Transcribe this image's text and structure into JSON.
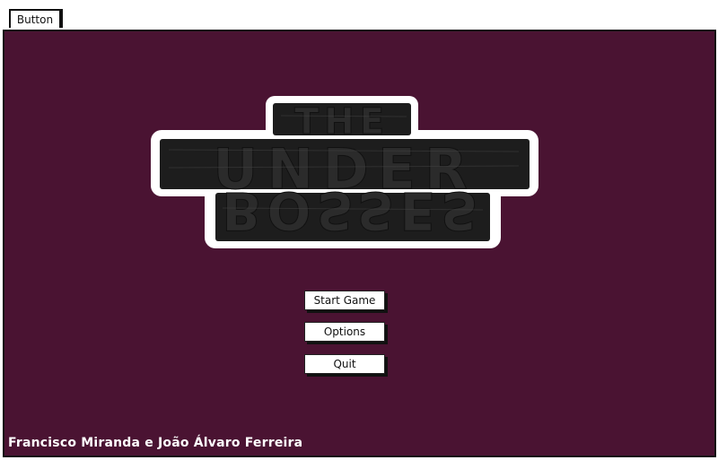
{
  "window": {
    "tab_label": "Button"
  },
  "logo": {
    "line1": "THE",
    "line2": "UNDER",
    "line3": "BOSSES"
  },
  "menu": {
    "start_label": "Start Game",
    "options_label": "Options",
    "quit_label": "Quit"
  },
  "footer": {
    "credits": "Francisco Miranda e João Álvaro Ferreira"
  },
  "colors": {
    "background": "#4a1332",
    "logo_fill": "#1a1a1a",
    "logo_outline": "#ffffff"
  }
}
